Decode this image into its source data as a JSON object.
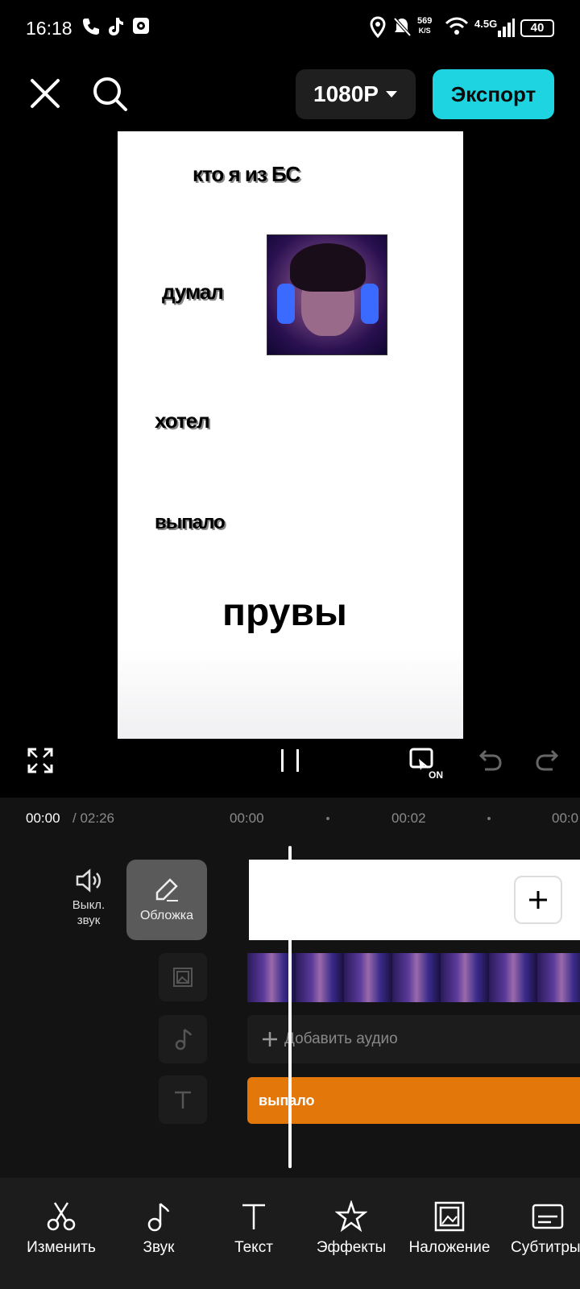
{
  "status_bar": {
    "time": "16:18",
    "net_speed": "569",
    "net_unit": "K/S",
    "network": "4.5G",
    "battery": "40"
  },
  "toolbar": {
    "resolution": "1080P",
    "export_label": "Экспорт"
  },
  "preview": {
    "text1": "кто я из БС",
    "text2": "думал",
    "text3": "хотел",
    "text4": "выпало",
    "text5": "прувы"
  },
  "timeline": {
    "current_time": "00:00",
    "total_time": "/ 02:26",
    "tick1": "00:00",
    "tick2": "00:02",
    "tick3": "00:0",
    "mute_label": "Выкл. звук",
    "cover_label": "Обложка",
    "add_audio_label": "Добавить аудио",
    "text_clip_label": "выпало"
  },
  "bottom_tools": [
    {
      "label": "Изменить",
      "icon": "scissors-icon"
    },
    {
      "label": "Звук",
      "icon": "music-note-icon"
    },
    {
      "label": "Текст",
      "icon": "text-icon"
    },
    {
      "label": "Эффекты",
      "icon": "effects-star-icon"
    },
    {
      "label": "Наложение",
      "icon": "overlay-icon"
    },
    {
      "label": "Субтитры",
      "icon": "subtitles-icon"
    }
  ]
}
